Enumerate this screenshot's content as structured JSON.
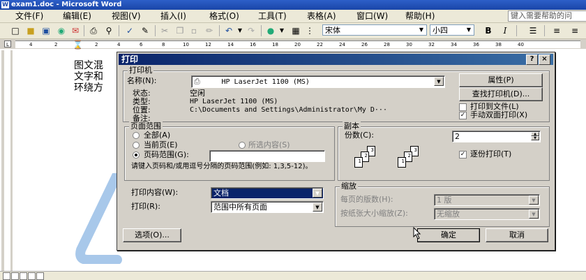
{
  "window": {
    "title": "exam1.doc - Microsoft Word"
  },
  "menu": {
    "items": [
      "文件(F)",
      "编辑(E)",
      "视图(V)",
      "插入(I)",
      "格式(O)",
      "工具(T)",
      "表格(A)",
      "窗口(W)",
      "帮助(H)"
    ],
    "help_placeholder": "键入需要帮助的问"
  },
  "toolbar": {
    "font_name": "宋体",
    "font_size": "小四",
    "bold": "B",
    "italic": "I"
  },
  "ruler": {
    "numbers": [
      "4",
      "2",
      "2",
      "4",
      "6",
      "8",
      "10",
      "12",
      "14",
      "16",
      "18",
      "20",
      "22",
      "24",
      "26",
      "28",
      "30",
      "32",
      "34",
      "36",
      "38",
      "40"
    ]
  },
  "document": {
    "lines": [
      "图文混",
      "文字和",
      "环绕方"
    ]
  },
  "dialog": {
    "title": "打印",
    "help_btn": "?",
    "close_btn": "×",
    "printer": {
      "group": "打印机",
      "name_label": "名称(N):",
      "name_value": "HP LaserJet 1100 (MS)",
      "status_label": "状态:",
      "status_value": "空闲",
      "type_label": "类型:",
      "type_value": "HP LaserJet 1100 (MS)",
      "where_label": "位置:",
      "where_value": "C:\\Documents and Settings\\Administrator\\My D···",
      "comment_label": "备注:",
      "properties_btn": "属性(P)",
      "find_btn": "查找打印机(D)...",
      "print_to_file": "打印到文件(L)",
      "manual_duplex": "手动双面打印(X)",
      "print_to_file_checked": false,
      "manual_duplex_checked": true
    },
    "page_range": {
      "group": "页面范围",
      "all": "全部(A)",
      "current": "当前页(E)",
      "selection": "所选内容(S)",
      "pages": "页码范围(G):",
      "selected": "pages",
      "pages_value": "",
      "hint": "请键入页码和/或用逗号分隔的页码范围(例如: 1,3,5-12)。"
    },
    "copies": {
      "group": "副本",
      "label": "份数(C):",
      "value": "2",
      "collate": "逐份打印(T)",
      "collate_checked": true
    },
    "print_what_label": "打印内容(W):",
    "print_what_value": "文档",
    "print_label": "打印(R):",
    "print_value": "范围中所有页面",
    "zoom": {
      "group": "缩放",
      "pps_label": "每页的版数(H):",
      "pps_value": "1 版",
      "scale_label": "按纸张大小缩放(Z):",
      "scale_value": "无缩放"
    },
    "options_btn": "选项(O)...",
    "ok_btn": "确定",
    "cancel_btn": "取消"
  },
  "colors": {
    "title_bar": "#1a46a8",
    "dialog_title": "#0a246a",
    "face": "#d4d0c8",
    "shape": "#a8c8ea"
  }
}
